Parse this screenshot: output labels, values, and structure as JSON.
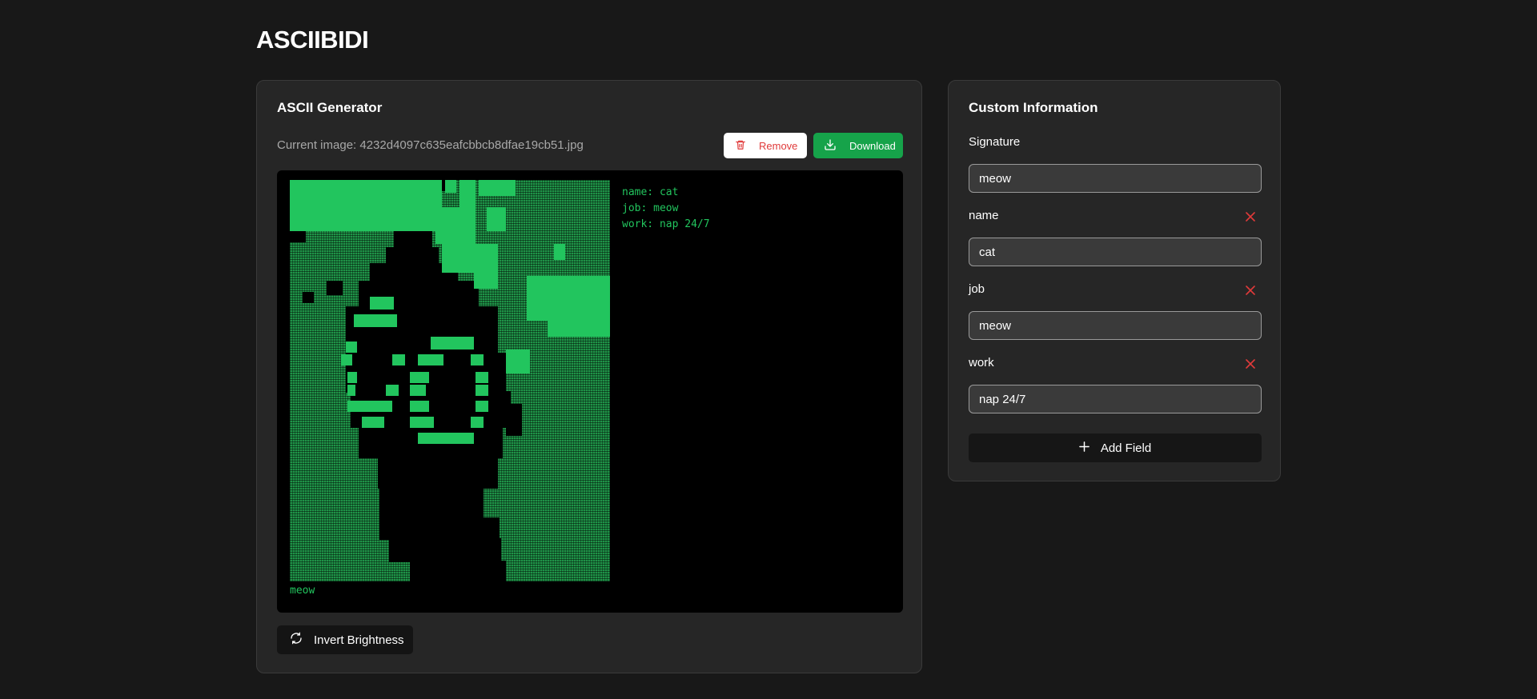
{
  "app": {
    "title": "ASCIIBIDI"
  },
  "generator": {
    "title": "ASCII Generator",
    "current_image": "Current image: 4232d4097c635eafcbbcb8dfae19cb51.jpg",
    "remove_label": "Remove",
    "download_label": "Download",
    "ascii_signature": "meow",
    "ascii_fields": [
      "name: cat",
      "job: meow",
      "work: nap 24/7"
    ],
    "invert_label": "Invert Brightness",
    "accent_color": "#22c55e"
  },
  "info": {
    "title": "Custom Information",
    "signature_label": "Signature",
    "signature_value": "meow",
    "fields": [
      {
        "label": "name",
        "value": "cat"
      },
      {
        "label": "job",
        "value": "meow"
      },
      {
        "label": "work",
        "value": "nap 24/7"
      }
    ],
    "add_field_label": "Add Field"
  },
  "icons": {
    "remove": "trash-icon",
    "download": "download-icon",
    "invert": "refresh-icon",
    "field_remove": "close-icon",
    "add": "plus-icon"
  },
  "colors": {
    "background": "#181818",
    "card": "#262626",
    "download": "#16a34a",
    "danger": "#e03a3a"
  }
}
